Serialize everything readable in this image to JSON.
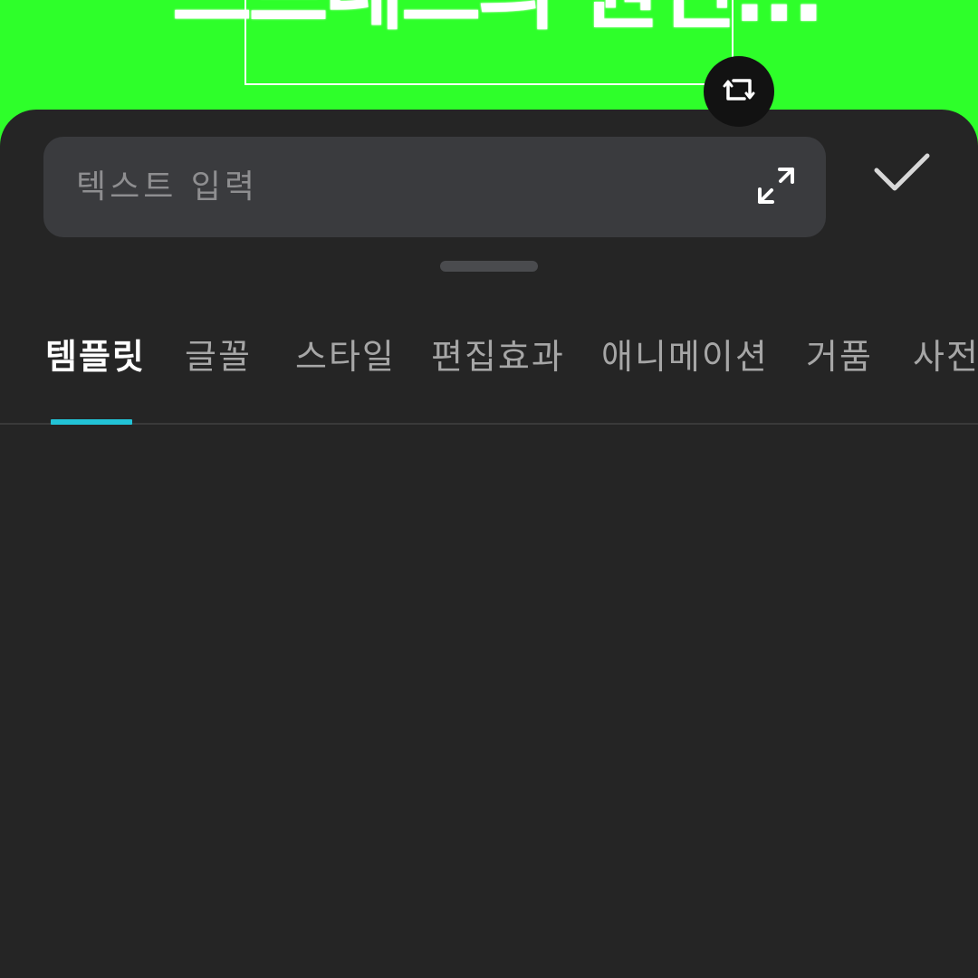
{
  "canvas": {
    "preview_text": "스트레스의 원인...",
    "background_color": "#2eff2a"
  },
  "editor": {
    "input": {
      "value": "",
      "placeholder": "텍스트 입력"
    },
    "icons": {
      "transform": "rotate-flip-icon",
      "expand": "expand-arrows-icon",
      "confirm": "checkmark-icon"
    }
  },
  "tabs": [
    {
      "label": "템플릿",
      "active": true
    },
    {
      "label": "글꼴",
      "active": false
    },
    {
      "label": "스타일",
      "active": false
    },
    {
      "label": "편집효과",
      "active": false
    },
    {
      "label": "애니메이션",
      "active": false
    },
    {
      "label": "거품",
      "active": false
    },
    {
      "label": "사전",
      "active": false
    }
  ],
  "colors": {
    "panel_bg": "#252525",
    "input_bg": "#3a3b3e",
    "accent": "#22c3d6",
    "tab_inactive": "#a6a6a6",
    "tab_active": "#ffffff"
  }
}
